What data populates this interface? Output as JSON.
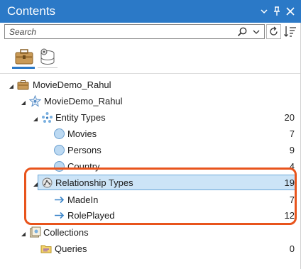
{
  "window": {
    "title": "Contents",
    "menu_icon": "chevron-down-icon",
    "pin_icon": "pin-icon",
    "close_icon": "close-icon"
  },
  "search": {
    "placeholder": "Search",
    "value": ""
  },
  "toolbar": {
    "refresh_icon": "refresh-icon",
    "sort_icon": "sort-icon"
  },
  "tabs": [
    {
      "name": "briefcase-tab",
      "icon": "briefcase-icon",
      "selected": true
    },
    {
      "name": "database-tab",
      "icon": "database-gear-icon",
      "selected": false
    }
  ],
  "tree": {
    "root": {
      "label": "MovieDemo_Rahul"
    },
    "knowledge_graph": {
      "label": "MovieDemo_Rahul"
    },
    "entity_types": {
      "label": "Entity Types",
      "count": "20",
      "items": [
        {
          "label": "Movies",
          "count": "7"
        },
        {
          "label": "Persons",
          "count": "9"
        },
        {
          "label": "Country",
          "count": "4"
        }
      ]
    },
    "relationship_types": {
      "label": "Relationship Types",
      "count": "19",
      "items": [
        {
          "label": "MadeIn",
          "count": "7"
        },
        {
          "label": "RolePlayed",
          "count": "12"
        }
      ]
    },
    "collections": {
      "label": "Collections",
      "items": [
        {
          "label": "Queries",
          "count": "0"
        }
      ]
    }
  },
  "colors": {
    "header": "#2b79c7",
    "selection": "#cce4f7",
    "annotation": "#e8541c"
  }
}
